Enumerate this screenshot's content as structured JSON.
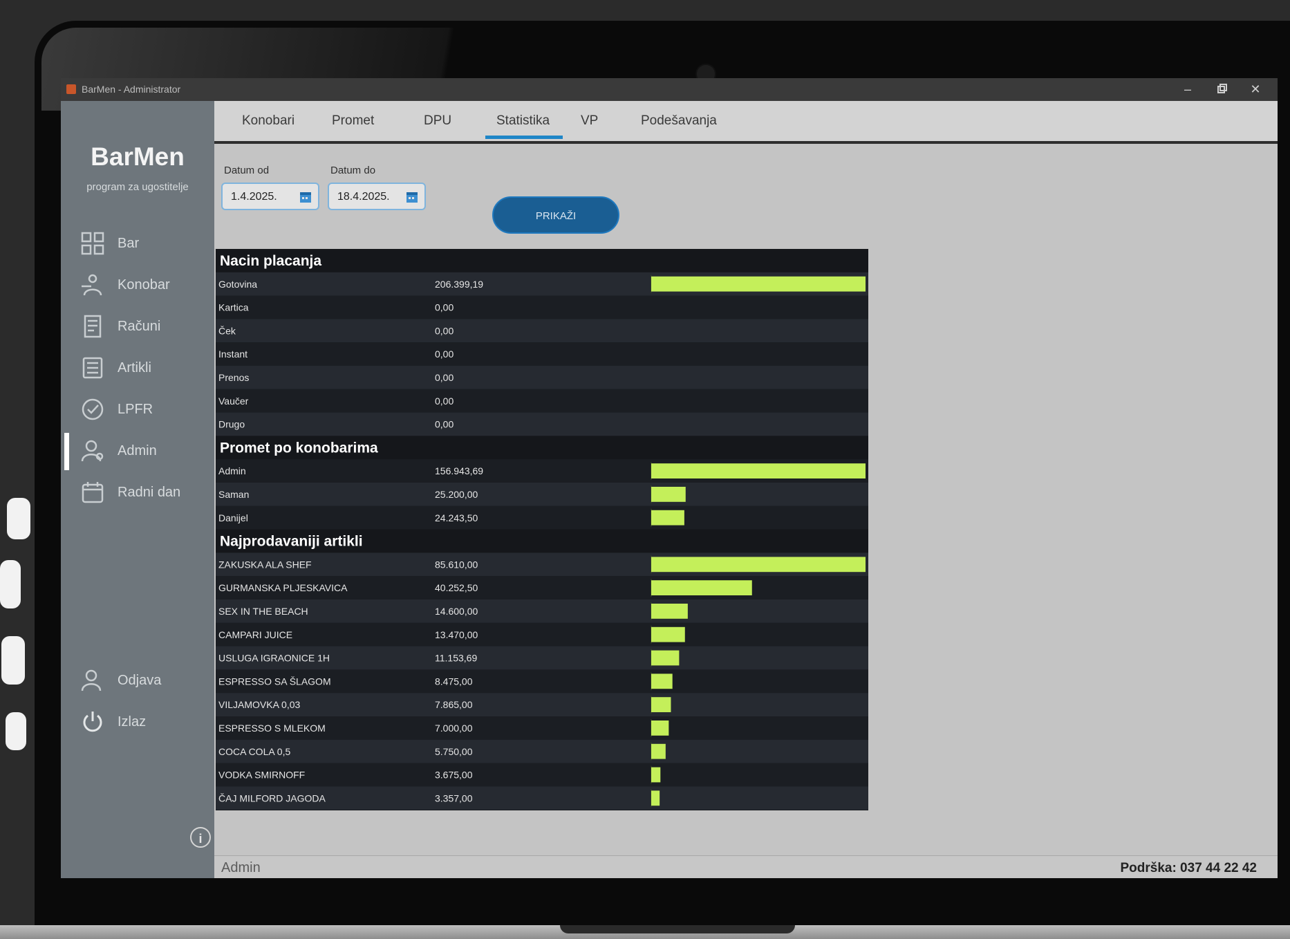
{
  "window": {
    "title": "BarMen - Administrator"
  },
  "brand": {
    "name": "BarMen",
    "subtitle": "program za ugostitelje"
  },
  "sidebar": {
    "items": [
      {
        "label": "Bar",
        "icon": "bar-grid-icon"
      },
      {
        "label": "Konobar",
        "icon": "waiter-icon"
      },
      {
        "label": "Računi",
        "icon": "receipt-icon"
      },
      {
        "label": "Artikli",
        "icon": "articles-icon"
      },
      {
        "label": "LPFR",
        "icon": "lpfr-icon"
      },
      {
        "label": "Admin",
        "icon": "admin-user-icon",
        "active": true
      },
      {
        "label": "Radni dan",
        "icon": "workday-icon"
      }
    ],
    "bottom_items": [
      {
        "label": "Odjava",
        "icon": "logout-user-icon"
      },
      {
        "label": "Izlaz",
        "icon": "power-icon"
      }
    ]
  },
  "tabs": [
    {
      "label": "Konobari"
    },
    {
      "label": "Promet"
    },
    {
      "label": "DPU"
    },
    {
      "label": "Statistika",
      "active": true
    },
    {
      "label": "VP"
    },
    {
      "label": "Podešavanja"
    }
  ],
  "filters": {
    "from_label": "Datum od",
    "from_value": "1.4.2025.",
    "to_label": "Datum do",
    "to_value": "18.4.2025.",
    "show_button": "PRIKAŽI"
  },
  "accent_color": "#1f86c7",
  "bar_color": "#c4ef5a",
  "status": {
    "user": "Admin",
    "support": "Podrška: 037 44 22 42"
  },
  "chart_data": {
    "type": "table",
    "sections": [
      {
        "title": "Nacin placanja",
        "rows": [
          {
            "label": "Gotovina",
            "value_text": "206.399,19",
            "value": 206399.19
          },
          {
            "label": "Kartica",
            "value_text": "0,00",
            "value": 0
          },
          {
            "label": "Ček",
            "value_text": "0,00",
            "value": 0
          },
          {
            "label": "Instant",
            "value_text": "0,00",
            "value": 0
          },
          {
            "label": "Prenos",
            "value_text": "0,00",
            "value": 0
          },
          {
            "label": "Vaučer",
            "value_text": "0,00",
            "value": 0
          },
          {
            "label": "Drugo",
            "value_text": "0,00",
            "value": 0
          }
        ]
      },
      {
        "title": "Promet po konobarima",
        "rows": [
          {
            "label": "Admin",
            "value_text": "156.943,69",
            "value": 156943.69
          },
          {
            "label": "Saman",
            "value_text": "25.200,00",
            "value": 25200
          },
          {
            "label": "Danijel",
            "value_text": "24.243,50",
            "value": 24243.5
          }
        ]
      },
      {
        "title": "Najprodavaniji artikli",
        "rows": [
          {
            "label": "ZAKUSKA ALA SHEF",
            "value_text": "85.610,00",
            "value": 85610
          },
          {
            "label": "GURMANSKA PLJESKAVICA",
            "value_text": "40.252,50",
            "value": 40252.5
          },
          {
            "label": "SEX IN THE BEACH",
            "value_text": "14.600,00",
            "value": 14600
          },
          {
            "label": "CAMPARI JUICE",
            "value_text": "13.470,00",
            "value": 13470
          },
          {
            "label": "USLUGA IGRAONICE 1H",
            "value_text": "11.153,69",
            "value": 11153.69
          },
          {
            "label": "ESPRESSO SA ŠLAGOM",
            "value_text": "8.475,00",
            "value": 8475
          },
          {
            "label": "VILJAMOVKA 0,03",
            "value_text": "7.865,00",
            "value": 7865
          },
          {
            "label": "ESPRESSO S MLEKOM",
            "value_text": "7.000,00",
            "value": 7000
          },
          {
            "label": "COCA COLA 0,5",
            "value_text": "5.750,00",
            "value": 5750
          },
          {
            "label": "VODKA SMIRNOFF",
            "value_text": "3.675,00",
            "value": 3675
          },
          {
            "label": "ČAJ MILFORD JAGODA",
            "value_text": "3.357,00",
            "value": 3357
          }
        ]
      }
    ]
  }
}
